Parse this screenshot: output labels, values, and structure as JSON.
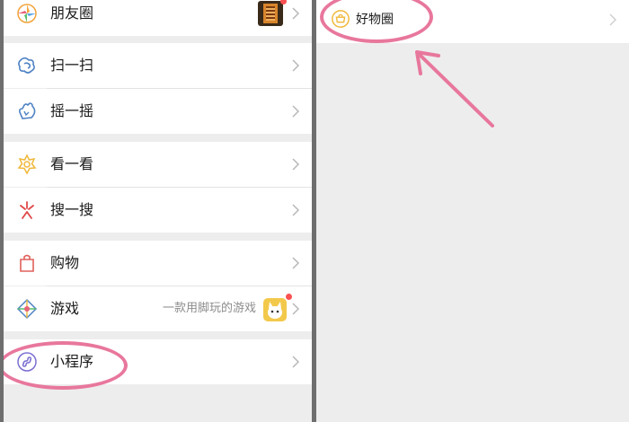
{
  "left_menu": {
    "moments": {
      "label": "朋友圈",
      "icon": "moments-aperture-icon"
    },
    "scan": {
      "label": "扫一扫",
      "icon": "scan-icon"
    },
    "shake": {
      "label": "摇一摇",
      "icon": "shake-icon"
    },
    "top_stories": {
      "label": "看一看",
      "icon": "top-stories-icon"
    },
    "search": {
      "label": "搜一搜",
      "icon": "search-sparkle-icon"
    },
    "shopping": {
      "label": "购物",
      "icon": "shopping-bag-icon"
    },
    "games": {
      "label": "游戏",
      "subtitle": "一款用脚玩的游戏",
      "icon": "game-diamond-icon"
    },
    "mini_programs": {
      "label": "小程序",
      "icon": "mini-program-icon"
    }
  },
  "right_menu": {
    "haowuquan": {
      "label": "好物圈",
      "icon": "haowuquan-icon"
    }
  },
  "colors": {
    "highlight": "#e8779c",
    "badge": "#fa5151",
    "background": "#ededed"
  }
}
